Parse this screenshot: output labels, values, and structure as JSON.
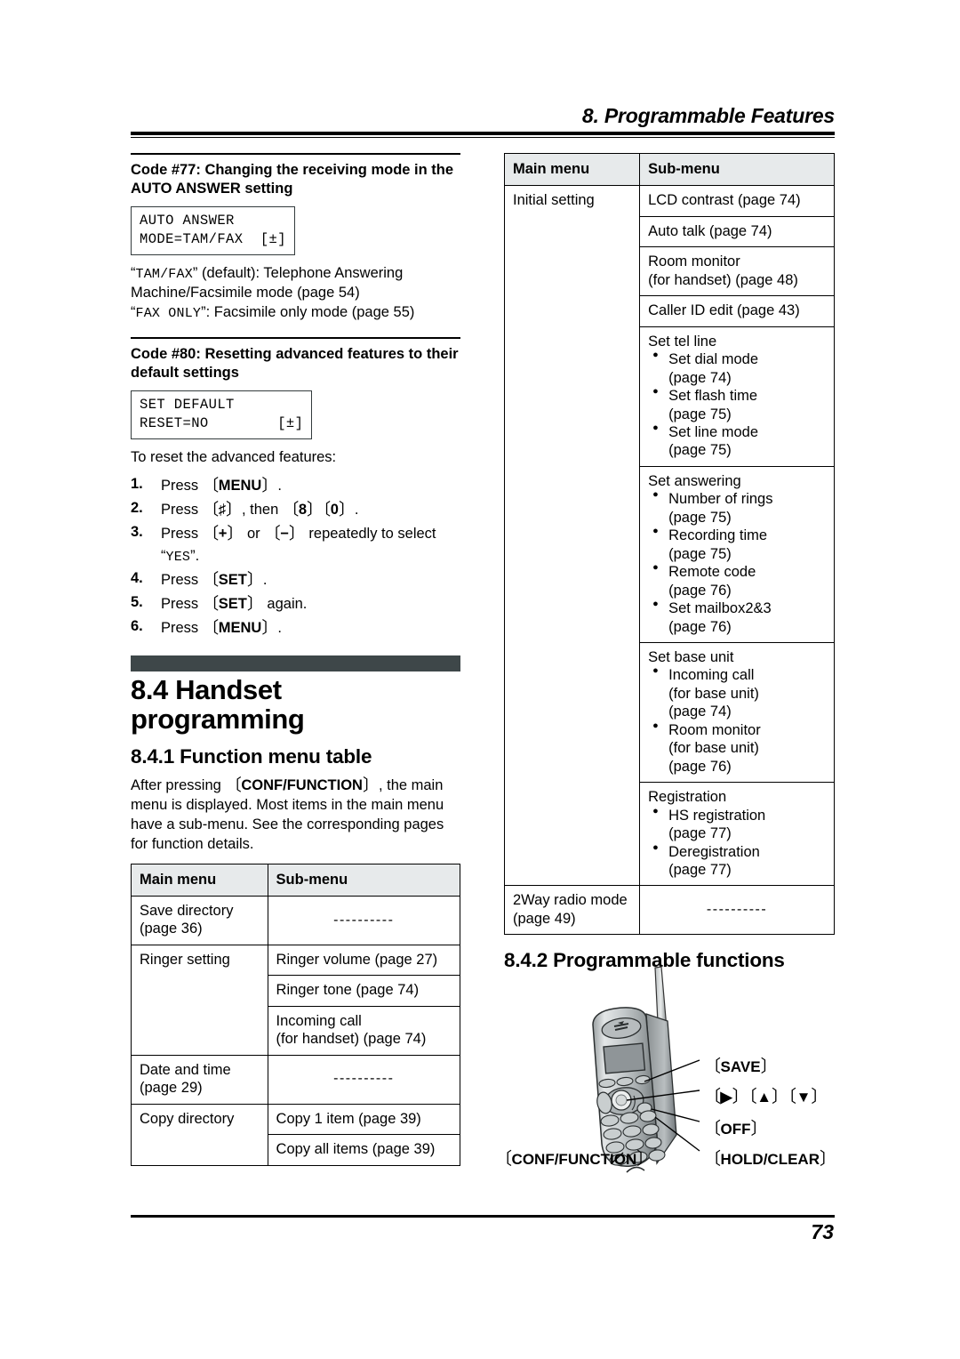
{
  "header": {
    "chapter_title": "8. Programmable Features"
  },
  "footer": {
    "page_number": "73"
  },
  "left_column": {
    "code77": {
      "heading": "Code #77: Changing the receiving mode in the AUTO ANSWER setting",
      "lcd_line1": "AUTO ANSWER",
      "lcd_line2": "MODE=TAM/FAX  [±]",
      "desc_line1_quote": "TAM/FAX",
      "desc_line1_rest": " (default): Telephone Answering",
      "desc_line2": "Machine/Facsimile mode (page 54)",
      "desc_line3_quote": "FAX ONLY",
      "desc_line3_rest": ": Facsimile only mode (page 55)"
    },
    "code80": {
      "heading": "Code #80: Resetting advanced features to their default settings",
      "lcd_line1": "SET DEFAULT",
      "lcd_line2": "RESET=NO        [±]",
      "intro": "To reset the advanced features:",
      "steps": [
        {
          "num": "1.",
          "pre": "Press ",
          "keys": [
            "MENU"
          ],
          "post": "."
        },
        {
          "num": "2.",
          "pre": "Press ",
          "keys": [
            "♯"
          ],
          "mid": ", then ",
          "keys2": [
            "8",
            "0"
          ],
          "post": "."
        },
        {
          "num": "3.",
          "pre": "Press ",
          "keys": [
            "+"
          ],
          "mid": " or ",
          "keys2": [
            "−"
          ],
          "post": " repeatedly to select “YES”.",
          "post_mono": "YES"
        },
        {
          "num": "4.",
          "pre": "Press ",
          "keys": [
            "SET"
          ],
          "post": "."
        },
        {
          "num": "5.",
          "pre": "Press ",
          "keys": [
            "SET"
          ],
          "post": " again."
        },
        {
          "num": "6.",
          "pre": "Press ",
          "keys": [
            "MENU"
          ],
          "post": "."
        }
      ]
    },
    "section_8_4": {
      "title": "8.4 Handset programming"
    },
    "section_8_4_1": {
      "title": "8.4.1 Function menu table",
      "para_pre": "After pressing ",
      "para_key": "CONF/FUNCTION",
      "para_post": ", the main menu is displayed. Most items in the main menu have a sub-menu. See the corresponding pages for function details."
    },
    "table": {
      "headers": [
        "Main menu",
        "Sub-menu"
      ],
      "rows": [
        {
          "main": "Save directory\n(page 36)",
          "main_rowspan": 1,
          "subs": [
            {
              "text": "----------",
              "dashes": true
            }
          ]
        },
        {
          "main": "Ringer setting",
          "main_rowspan": 3,
          "subs": [
            {
              "text": "Ringer volume (page 27)"
            },
            {
              "text": "Ringer tone (page 74)"
            },
            {
              "text": "Incoming call\n(for handset) (page 74)"
            }
          ]
        },
        {
          "main": "Date and time\n(page 29)",
          "main_rowspan": 1,
          "subs": [
            {
              "text": "----------",
              "dashes": true
            }
          ]
        },
        {
          "main": "Copy directory",
          "main_rowspan": 2,
          "subs": [
            {
              "text": "Copy 1 item (page 39)"
            },
            {
              "text": "Copy all items (page 39)"
            }
          ]
        }
      ]
    }
  },
  "right_column": {
    "table": {
      "headers": [
        "Main menu",
        "Sub-menu"
      ],
      "rows": [
        {
          "main": "Initial setting",
          "main_rowspan": 8,
          "subs": [
            {
              "text": "LCD contrast (page 74)"
            },
            {
              "text": "Auto talk (page 74)"
            },
            {
              "text": "Room monitor\n(for handset) (page 48)"
            },
            {
              "text": "Caller ID edit (page 43)"
            },
            {
              "title": "Set tel line",
              "bullets": [
                "Set dial mode\n(page 74)",
                "Set flash time\n(page 75)",
                "Set line mode\n(page 75)"
              ]
            },
            {
              "title": "Set answering",
              "bullets": [
                "Number of rings\n(page 75)",
                "Recording time\n(page 75)",
                "Remote code\n(page 76)",
                "Set mailbox2&3\n(page 76)"
              ]
            },
            {
              "title": "Set base unit",
              "bullets": [
                "Incoming call\n(for base unit)\n(page 74)",
                "Room monitor\n(for base unit)\n(page 76)"
              ]
            },
            {
              "title": "Registration",
              "bullets": [
                "HS registration\n(page 77)",
                "Deregistration\n(page 77)"
              ]
            }
          ]
        },
        {
          "main": "2Way radio mode\n(page 49)",
          "main_rowspan": 1,
          "subs": [
            {
              "text": "----------",
              "dashes": true
            }
          ]
        }
      ]
    },
    "section_8_4_2": {
      "title": "8.4.2 Programmable functions"
    },
    "figure": {
      "labels": {
        "save": "SAVE",
        "nav": "▶ )( ▲ )( ▼",
        "nav_parts": [
          "▶",
          "▲",
          "▼"
        ],
        "off": "OFF",
        "hold_clear": "HOLD/CLEAR",
        "conf_function": "CONF/FUNCTION"
      }
    }
  },
  "colors": {
    "section_bar": "#3e4749",
    "table_header_bg": "#e7eaeb",
    "text": "#000000"
  }
}
